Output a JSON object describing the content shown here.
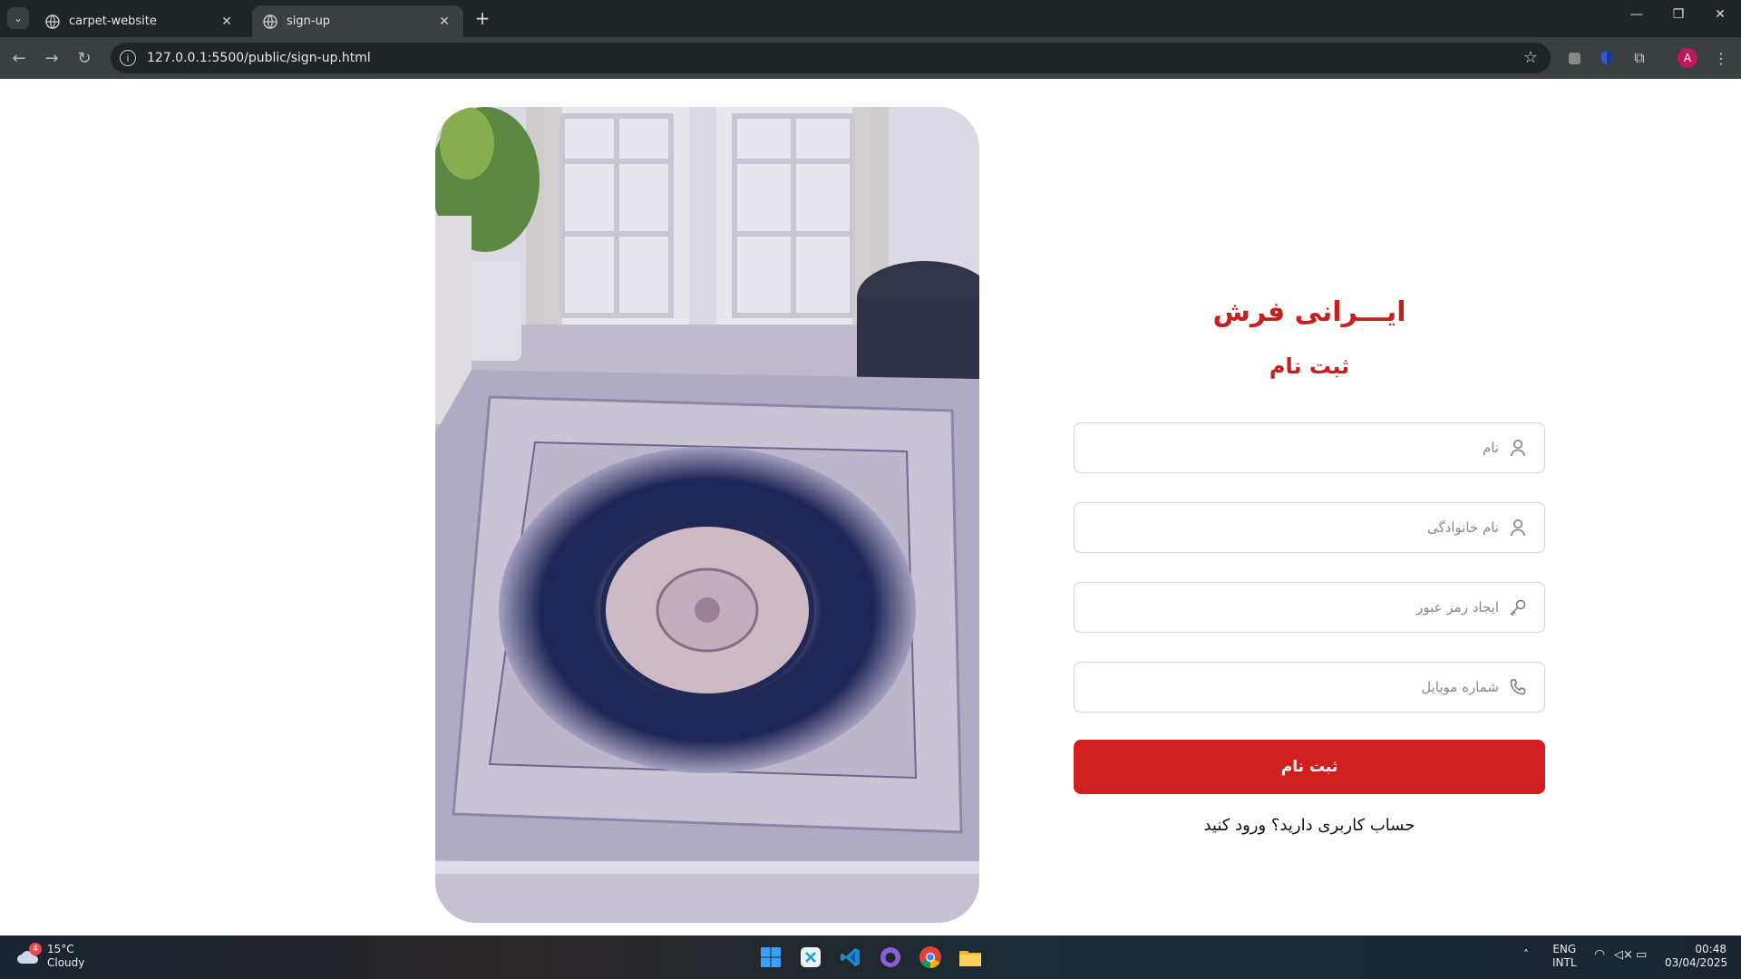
{
  "browser": {
    "tabs": [
      {
        "title": "carpet-website",
        "active": false
      },
      {
        "title": "sign-up",
        "active": true
      }
    ],
    "url": "127.0.0.1:5500/public/sign-up.html",
    "profile_initial": "A"
  },
  "page": {
    "brand": "ایـــرانی فرش",
    "subtitle": "ثبت نام",
    "fields": {
      "first_name_placeholder": "نام",
      "last_name_placeholder": "نام خانوادگی",
      "password_placeholder": "ایجاد رمز عبور",
      "mobile_placeholder": "شماره موبایل"
    },
    "submit_label": "ثبت نام",
    "login_prompt": "حساب کاربری دارید؟ ورود کنید",
    "accent_color": "#d01f1f"
  },
  "taskbar": {
    "weather_temp": "15°C",
    "weather_desc": "Cloudy",
    "weather_badge": "4",
    "lang_line1": "ENG",
    "lang_line2": "INTL",
    "time": "00:48",
    "date": "03/04/2025"
  }
}
